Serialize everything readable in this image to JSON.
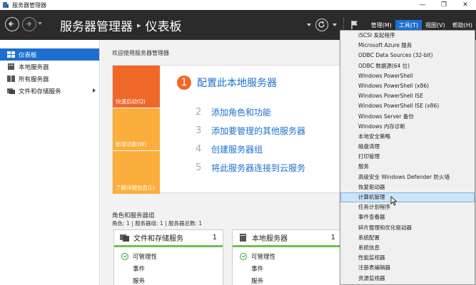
{
  "window": {
    "title": "服务器管理器",
    "minimize": "—",
    "maximize": "❐",
    "close": "✕"
  },
  "header": {
    "breadcrumb_root": "服务器管理器",
    "breadcrumb_sep": "▸",
    "breadcrumb_current": "仪表板",
    "menu": [
      {
        "label": "管理(M)"
      },
      {
        "label": "工具(T)"
      },
      {
        "label": "视图(V)"
      },
      {
        "label": "帮助(H)"
      }
    ],
    "accent": "#1e6fd0"
  },
  "sidebar": {
    "items": [
      {
        "label": "仪表板"
      },
      {
        "label": "本地服务器"
      },
      {
        "label": "所有服务器"
      },
      {
        "label": "文件和存储服务"
      }
    ]
  },
  "main": {
    "welcome_title": "欢迎使用服务器管理器",
    "tiles": [
      {
        "label": "快速启动(Q)"
      },
      {
        "label": "新增功能(W)"
      },
      {
        "label": "了解详细信息(L)"
      }
    ],
    "steps": [
      {
        "num": "1",
        "text": "配置此本地服务器"
      },
      {
        "num": "2",
        "text": "添加角色和功能"
      },
      {
        "num": "3",
        "text": "添加要管理的其他服务器"
      },
      {
        "num": "4",
        "text": "创建服务器组"
      },
      {
        "num": "5",
        "text": "将此服务器连接到云服务"
      }
    ],
    "roles_title": "角色和服务器组",
    "roles_sub": "角色: 1 | 服务器组: 1 | 服务器总数: 1",
    "cards": [
      {
        "title": "文件和存储服务",
        "count": "1",
        "manageability": "可管理性",
        "events": "事件",
        "more": "服务"
      },
      {
        "title": "本地服务器",
        "count": "1",
        "manageability": "可管理性",
        "events": "事件",
        "more": "服务"
      }
    ]
  },
  "tools_menu": {
    "items": [
      "iSCSI 发起程序",
      "Microsoft Azure 服务",
      "ODBC Data Sources (32-bit)",
      "ODBC 数据源(64 位)",
      "Windows PowerShell",
      "Windows PowerShell (x86)",
      "Windows PowerShell ISE",
      "Windows PowerShell ISE (x86)",
      "Windows Server 备份",
      "Windows 内存诊断",
      "本地安全策略",
      "磁盘清理",
      "打印管理",
      "服务",
      "高级安全 Windows Defender 防火墙",
      "恢复驱动器",
      "计算机管理",
      "任务计划程序",
      "事件查看器",
      "碎片整理和优化驱动器",
      "系统配置",
      "系统信息",
      "性能监视器",
      "注册表编辑器",
      "资源监视器"
    ],
    "highlighted_index": 16
  }
}
